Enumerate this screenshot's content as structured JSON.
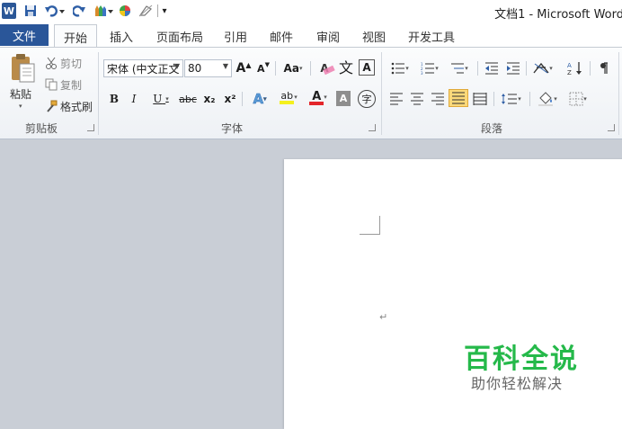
{
  "titlebar": {
    "title": "文档1 - Microsoft Word",
    "word_glyph": "W",
    "customize_glyph": "▾"
  },
  "tabs": [
    {
      "label": "文件"
    },
    {
      "label": "开始"
    },
    {
      "label": "插入"
    },
    {
      "label": "页面布局"
    },
    {
      "label": "引用"
    },
    {
      "label": "邮件"
    },
    {
      "label": "审阅"
    },
    {
      "label": "视图"
    },
    {
      "label": "开发工具"
    }
  ],
  "clipboard": {
    "paste": "粘贴",
    "cut": "剪切",
    "copy": "复制",
    "format_painter": "格式刷",
    "group_label": "剪贴板"
  },
  "font": {
    "font_name": "宋体 (中文正文",
    "font_size": "80",
    "grow": "A",
    "shrink": "A",
    "change_case": "Aa",
    "clear_format": "A",
    "phonetic": "文",
    "char_border": "A",
    "bold": "B",
    "italic": "I",
    "underline": "U",
    "strike": "abc",
    "subscript": "x₂",
    "superscript": "x²",
    "text_effect": "A",
    "highlight": "ab",
    "font_color": "A",
    "char_shading": "A",
    "enclose": "字",
    "group_label": "字体"
  },
  "paragraph": {
    "group_label": "段落"
  },
  "colors": {
    "file_tab": "#2a5699",
    "font_color_bar": "#e3262b",
    "highlight_bar": "#f4f01e",
    "watermark_green": "#25b94a"
  },
  "watermark": {
    "main": "百科全说",
    "sub": "助你轻松解决"
  },
  "document": {
    "paragraph_mark": "↵"
  }
}
